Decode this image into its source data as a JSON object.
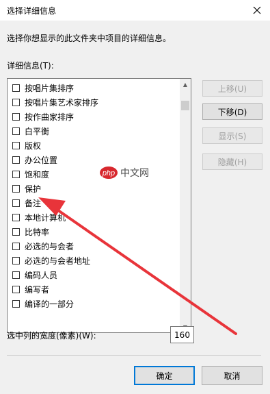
{
  "window": {
    "title": "选择详细信息"
  },
  "instruction": "选择你想显示的此文件夹中项目的详细信息。",
  "list": {
    "label": "详细信息(T):",
    "items": [
      {
        "label": "按唱片集排序"
      },
      {
        "label": "按唱片集艺术家排序"
      },
      {
        "label": "按作曲家排序"
      },
      {
        "label": "白平衡"
      },
      {
        "label": "版权"
      },
      {
        "label": "办公位置"
      },
      {
        "label": "饱和度"
      },
      {
        "label": "保护"
      },
      {
        "label": "备注"
      },
      {
        "label": "本地计算机"
      },
      {
        "label": "比特率"
      },
      {
        "label": "必选的与会者"
      },
      {
        "label": "必选的与会者地址"
      },
      {
        "label": "编码人员"
      },
      {
        "label": "编写者"
      },
      {
        "label": "编译的一部分"
      }
    ]
  },
  "buttons": {
    "move_up": "上移(U)",
    "move_down": "下移(D)",
    "show": "显示(S)",
    "hide": "隐藏(H)",
    "ok": "确定",
    "cancel": "取消"
  },
  "width": {
    "label": "选中列的宽度(像素)(W):",
    "value": "160"
  },
  "watermark": {
    "brand": "php",
    "text": "中文网"
  },
  "colors": {
    "accent": "#0078d7",
    "arrow": "#e8343a",
    "watermark_red": "#d8282e"
  }
}
